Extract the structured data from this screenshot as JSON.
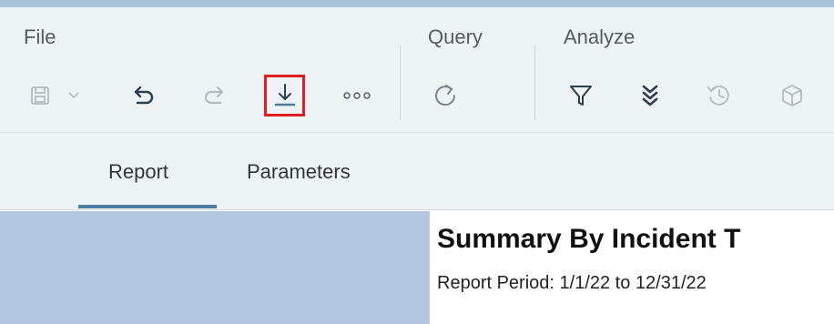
{
  "toolbar": {
    "groups": {
      "file": "File",
      "query": "Query",
      "analyze": "Analyze"
    },
    "icons": {
      "save": "save-icon",
      "save_dropdown": "chevron-down-icon",
      "undo": "undo-icon",
      "redo": "redo-icon",
      "export": "download-icon",
      "more": "more-icon",
      "refresh": "refresh-icon",
      "filter": "filter-icon",
      "drill": "double-chevron-down-icon",
      "history": "history-icon",
      "cube": "cube-icon"
    },
    "highlight_color": "#e02020"
  },
  "tabs": {
    "items": [
      {
        "label": "Report",
        "active": true
      },
      {
        "label": "Parameters",
        "active": false
      }
    ]
  },
  "report": {
    "title": "Summary By Incident T",
    "period": "Report Period: 1/1/22 to 12/31/22"
  },
  "colors": {
    "toolbar_bg": "#eef3f6",
    "accent": "#4f7d9f",
    "side_panel": "#b3c8de"
  }
}
